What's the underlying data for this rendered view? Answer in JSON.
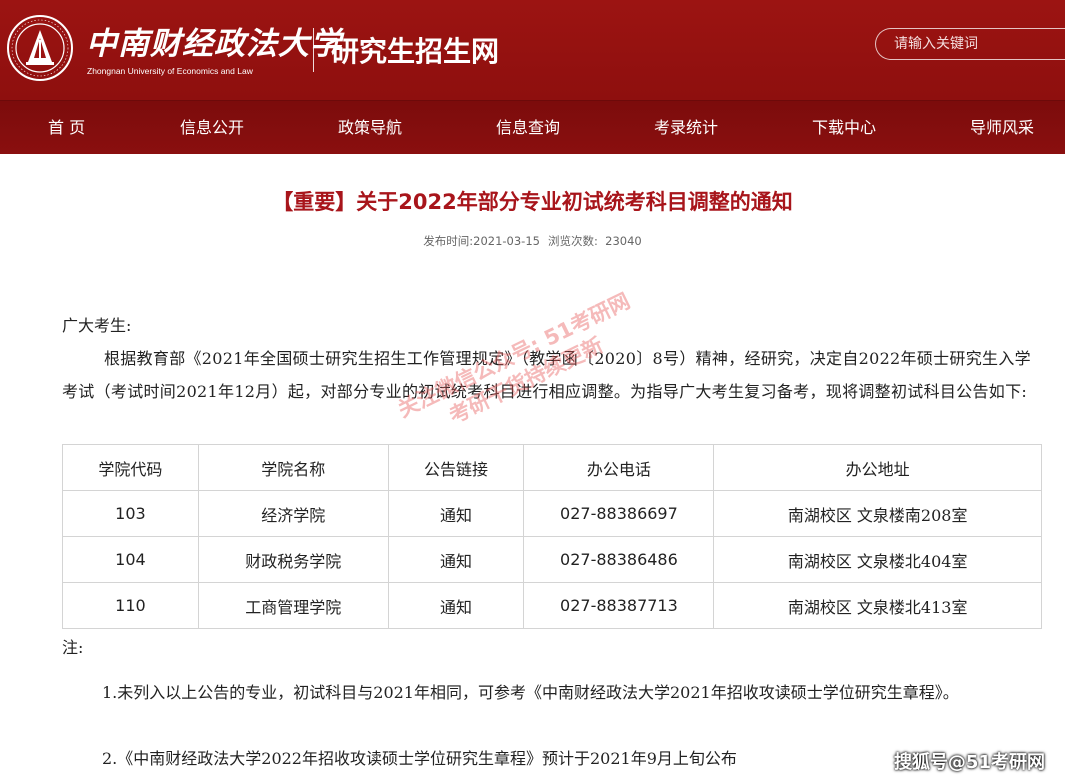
{
  "header": {
    "university_cn": "中南财经政法大学",
    "university_en": "Zhongnan University of Economics and Law",
    "site_title": "研究生招生网",
    "search_placeholder": "请输入关键词",
    "brand_color": "#9c1412"
  },
  "nav": {
    "items": [
      {
        "label": "首 页"
      },
      {
        "label": "信息公开"
      },
      {
        "label": "政策导航"
      },
      {
        "label": "信息查询"
      },
      {
        "label": "考录统计"
      },
      {
        "label": "下载中心"
      },
      {
        "label": "导师风采"
      }
    ]
  },
  "article": {
    "title": "【重要】关于2022年部分专业初试统考科目调整的通知",
    "publish_label": "发布时间:",
    "publish_date": "2021-03-15",
    "views_label": "浏览次数:",
    "views": "23040",
    "greeting": "广大考生:",
    "intro": "根据教育部《2021年全国硕士研究生招生工作管理规定》（教学函〔2020〕8号）精神，经研究，决定自2022年硕士研究生入学考试（考试时间2021年12月）起，对部分专业的初试统考科目进行相应调整。为指导广大考生复习备考，现将调整初试科目公告如下:",
    "table": {
      "headers": [
        "学院代码",
        "学院名称",
        "公告链接",
        "办公电话",
        "办公地址"
      ],
      "rows": [
        [
          "103",
          "经济学院",
          "通知",
          "027-88386697",
          "南湖校区  文泉楼南208室"
        ],
        [
          "104",
          "财政税务学院",
          "通知",
          "027-88386486",
          "南湖校区  文泉楼北404室"
        ],
        [
          "110",
          "工商管理学院",
          "通知",
          "027-88387713",
          "南湖校区  文泉楼北413室"
        ]
      ]
    },
    "note_label": "注:",
    "notes": [
      "1.未列入以上公告的专业，初试科目与2021年相同，可参考《中南财经政法大学2021年招收攻读硕士学位研究生章程》。",
      "2.《中南财经政法大学2022年招收攻读硕士学位研究生章程》预计于2021年9月上旬公布"
    ]
  },
  "overlay": {
    "watermark_line1": "关注微信公众号: 51考研网",
    "watermark_line2": "考研干货持续更新",
    "footer_watermark": "搜狐号@51考研网"
  }
}
